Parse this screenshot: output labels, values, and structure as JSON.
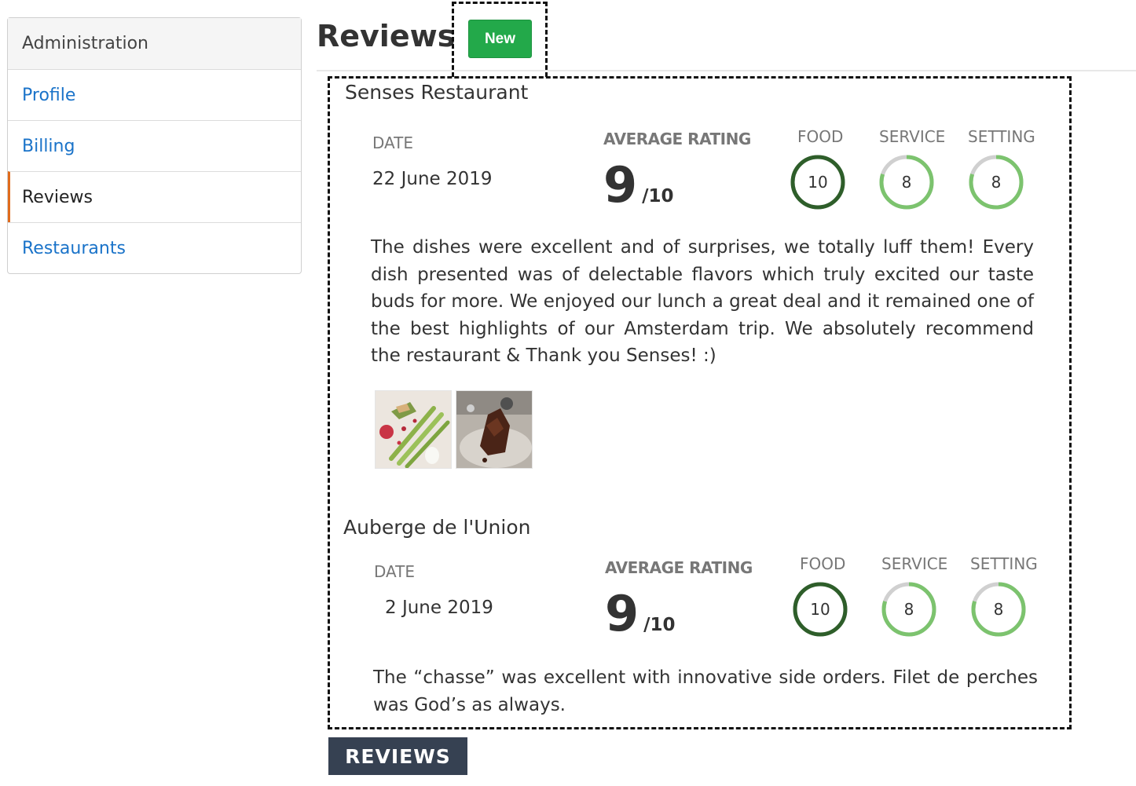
{
  "sidebar": {
    "items": [
      {
        "label": "Administration"
      },
      {
        "label": "Profile"
      },
      {
        "label": "Billing"
      },
      {
        "label": "Reviews"
      },
      {
        "label": "Restaurants"
      }
    ]
  },
  "header": {
    "title": "Reviews",
    "new_button": "New"
  },
  "reviews": [
    {
      "restaurant": "Senses Restaurant",
      "date_label": "DATE",
      "date": "22 June 2019",
      "avg_label": "AVERAGE RATING",
      "avg_score": "9",
      "avg_max": "/10",
      "scores": [
        {
          "label": "FOOD",
          "value": "10",
          "fraction": 1.0
        },
        {
          "label": "SERVICE",
          "value": "8",
          "fraction": 0.8
        },
        {
          "label": "SETTING",
          "value": "8",
          "fraction": 0.8
        }
      ],
      "text": "The dishes were excellent and of surprises, we totally luff them! Every dish presented was of delectable flavors which truly excited our taste buds for more. We enjoyed our lunch a great deal and it remained one of the best highlights of our Amsterdam trip. We absolutely recommend the restaurant & Thank you Senses! :)"
    },
    {
      "restaurant": "Auberge de l'Union",
      "date_label": "DATE",
      "date": "2 June 2019",
      "avg_label": "AVERAGE RATING",
      "avg_score": "9",
      "avg_max": "/10",
      "scores": [
        {
          "label": "FOOD",
          "value": "10",
          "fraction": 1.0
        },
        {
          "label": "SERVICE",
          "value": "8",
          "fraction": 0.8
        },
        {
          "label": "SETTING",
          "value": "8",
          "fraction": 0.8
        }
      ],
      "text": "The “chasse” was excellent with innovative side orders. Filet de perches was God’s as always."
    }
  ],
  "annotation_label": "REVIEWS",
  "colors": {
    "new_button": "#23a94a",
    "link": "#1a73c9",
    "active_marker": "#e06b1c",
    "full_score_ring": "#2e5e2a",
    "partial_score_ring": "#7cc36e",
    "ring_track": "#d0d0d0",
    "annotation_bg": "#364152"
  }
}
